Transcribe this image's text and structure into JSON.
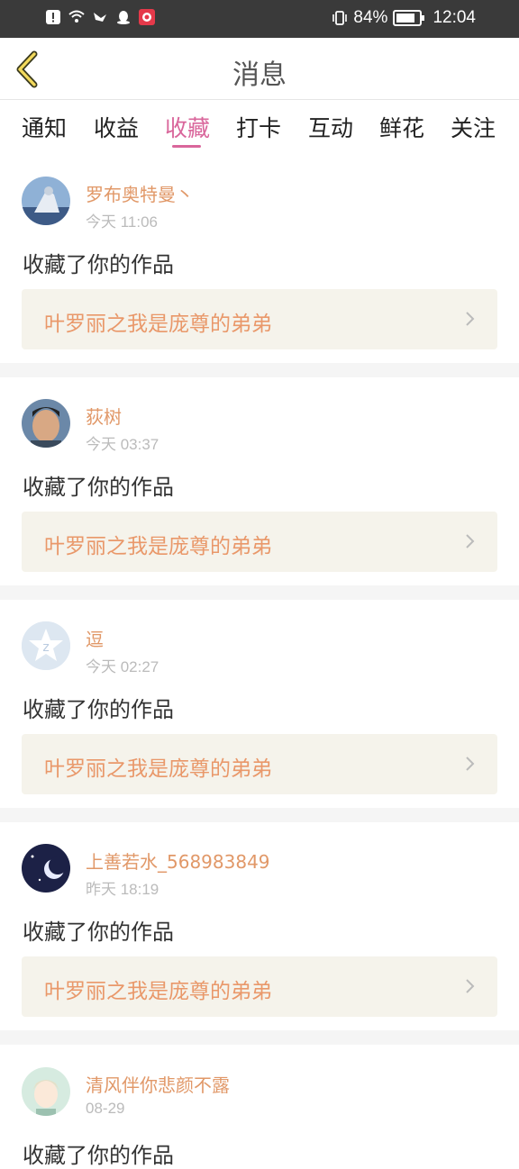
{
  "status_bar": {
    "battery": "84%",
    "time": "12:04",
    "battery_level": 0.84
  },
  "header": {
    "title": "消息"
  },
  "tabs": [
    {
      "label": "通知"
    },
    {
      "label": "收益"
    },
    {
      "label": "收藏"
    },
    {
      "label": "打卡"
    },
    {
      "label": "互动"
    },
    {
      "label": "鲜花"
    },
    {
      "label": "关注"
    }
  ],
  "active_tab": "收藏",
  "colors": {
    "accent": "#d9669b",
    "username": "#e19868",
    "work_title": "#e9986a",
    "work_bg": "#f5f3eb"
  },
  "items": [
    {
      "user": "罗布奥特曼丶",
      "time": "今天 11:06",
      "action": "收藏了你的作品",
      "work": "叶罗丽之我是庞尊的弟弟"
    },
    {
      "user": "荻树",
      "time": "今天 03:37",
      "action": "收藏了你的作品",
      "work": "叶罗丽之我是庞尊的弟弟"
    },
    {
      "user": "逗",
      "time": "今天 02:27",
      "action": "收藏了你的作品",
      "work": "叶罗丽之我是庞尊的弟弟"
    },
    {
      "user": "上善若水_568983849",
      "time": "昨天 18:19",
      "action": "收藏了你的作品",
      "work": "叶罗丽之我是庞尊的弟弟"
    },
    {
      "user": "清风伴你悲颜不露",
      "time": "08-29",
      "action": "收藏了你的作品",
      "work": ""
    }
  ]
}
